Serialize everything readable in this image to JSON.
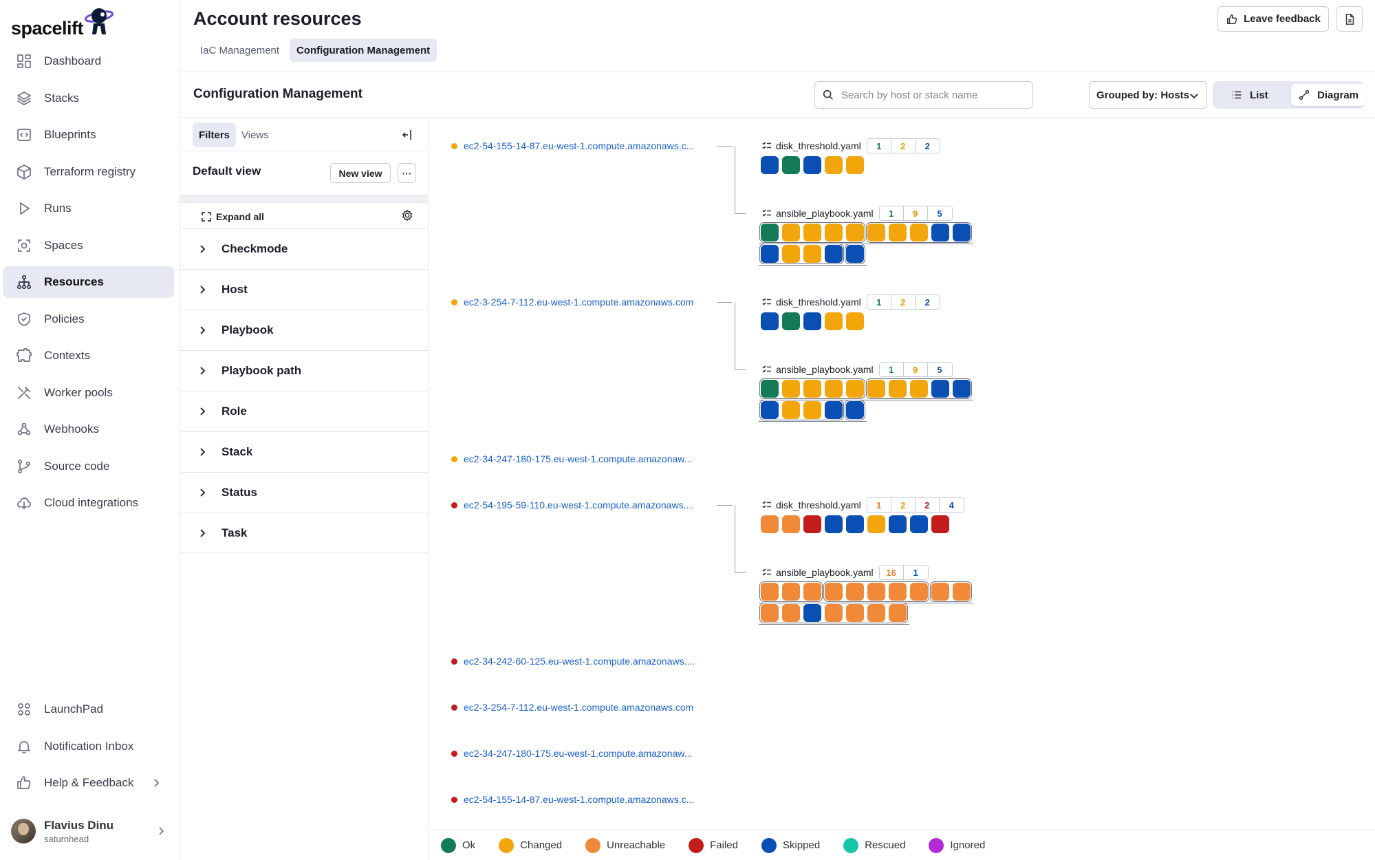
{
  "app": {
    "logo_text": "spacelift"
  },
  "sidebar": {
    "items": [
      {
        "label": "Dashboard",
        "icon": "dashboard-icon"
      },
      {
        "label": "Stacks",
        "icon": "stacks-icon"
      },
      {
        "label": "Blueprints",
        "icon": "blueprints-icon"
      },
      {
        "label": "Terraform registry",
        "icon": "registry-icon"
      },
      {
        "label": "Runs",
        "icon": "play-icon"
      },
      {
        "label": "Spaces",
        "icon": "spaces-icon"
      },
      {
        "label": "Resources",
        "icon": "resources-icon",
        "active": true
      },
      {
        "label": "Policies",
        "icon": "policies-icon"
      },
      {
        "label": "Contexts",
        "icon": "contexts-icon"
      },
      {
        "label": "Worker pools",
        "icon": "worker-pools-icon"
      },
      {
        "label": "Webhooks",
        "icon": "webhooks-icon"
      },
      {
        "label": "Source code",
        "icon": "source-code-icon"
      },
      {
        "label": "Cloud integrations",
        "icon": "cloud-icon"
      }
    ],
    "bottom_items": [
      {
        "label": "LaunchPad",
        "icon": "launchpad-icon"
      },
      {
        "label": "Notification Inbox",
        "icon": "bell-icon"
      },
      {
        "label": "Help & Feedback",
        "icon": "thumbs-up-icon"
      }
    ],
    "user": {
      "name": "Flavius Dinu",
      "handle": "saturnhead"
    }
  },
  "header": {
    "title": "Account resources",
    "tabs": [
      "IaC Management",
      "Configuration Management"
    ],
    "active_tab": 1,
    "feedback_label": "Leave feedback"
  },
  "subheader": {
    "title": "Configuration Management",
    "search_placeholder": "Search by host or stack name",
    "group_by": "Grouped by: Hosts",
    "view_list": "List",
    "view_diagram": "Diagram"
  },
  "filters": {
    "tabs": [
      "Filters",
      "Views"
    ],
    "default_view": "Default view",
    "new_view": "New view",
    "more": "···",
    "expand_all": "Expand all",
    "rows": [
      "Checkmode",
      "Host",
      "Playbook",
      "Playbook path",
      "Role",
      "Stack",
      "Status",
      "Task"
    ]
  },
  "colors": {
    "ok": "#157a56",
    "changed": "#f2a60c",
    "unreachable": "#f08a38",
    "failed": "#c21c1c",
    "skipped": "#0a4fb3",
    "rescued": "#18c5a8",
    "ignored": "#b32bd6",
    "badge_ok": "#157a56",
    "badge_changed": "#e49b00",
    "badge_unreachable": "#e8802f",
    "badge_failed": "#b51a1a",
    "badge_skipped": "#0a4fb3"
  },
  "hosts": [
    {
      "name": "ec2-54-155-14-87.eu-west-1.compute.amazonaws.c...",
      "status": "changed",
      "playbooks": [
        {
          "name": "disk_threshold.yaml",
          "badges": [
            [
              "ok",
              "1"
            ],
            [
              "changed",
              "2"
            ],
            [
              "skipped",
              "2"
            ]
          ],
          "rows": [
            [
              "skipped",
              "ok",
              "skipped",
              "changed",
              "changed"
            ]
          ],
          "groups": []
        },
        {
          "name": "ansible_playbook.yaml",
          "badges": [
            [
              "ok",
              "1"
            ],
            [
              "changed",
              "9"
            ],
            [
              "skipped",
              "5"
            ]
          ],
          "rows": [
            [
              "ok",
              "changed",
              "changed",
              "changed",
              "changed",
              "changed",
              "changed",
              "changed",
              "skipped",
              "skipped"
            ],
            [
              "skipped",
              "changed",
              "changed",
              "skipped",
              "skipped"
            ]
          ],
          "groups": [
            [
              0,
              0,
              5
            ],
            [
              0,
              5,
              5
            ],
            [
              1,
              0,
              4
            ],
            [
              1,
              4,
              1
            ]
          ]
        }
      ]
    },
    {
      "name": "ec2-3-254-7-112.eu-west-1.compute.amazonaws.com",
      "status": "changed",
      "playbooks": [
        {
          "name": "disk_threshold.yaml",
          "badges": [
            [
              "ok",
              "1"
            ],
            [
              "changed",
              "2"
            ],
            [
              "skipped",
              "2"
            ]
          ],
          "rows": [
            [
              "skipped",
              "ok",
              "skipped",
              "changed",
              "changed"
            ]
          ],
          "groups": []
        },
        {
          "name": "ansible_playbook.yaml",
          "badges": [
            [
              "ok",
              "1"
            ],
            [
              "changed",
              "9"
            ],
            [
              "skipped",
              "5"
            ]
          ],
          "rows": [
            [
              "ok",
              "changed",
              "changed",
              "changed",
              "changed",
              "changed",
              "changed",
              "changed",
              "skipped",
              "skipped"
            ],
            [
              "skipped",
              "changed",
              "changed",
              "skipped",
              "skipped"
            ]
          ],
          "groups": [
            [
              0,
              0,
              5
            ],
            [
              0,
              5,
              5
            ],
            [
              1,
              0,
              4
            ],
            [
              1,
              4,
              1
            ]
          ]
        }
      ]
    },
    {
      "name": "ec2-34-247-180-175.eu-west-1.compute.amazonaw...",
      "status": "changed",
      "playbooks": []
    },
    {
      "name": "ec2-54-195-59-110.eu-west-1.compute.amazonaws....",
      "status": "failed",
      "playbooks": [
        {
          "name": "disk_threshold.yaml",
          "badges": [
            [
              "unreachable",
              "1"
            ],
            [
              "changed",
              "2"
            ],
            [
              "failed",
              "2"
            ],
            [
              "skipped",
              "4"
            ]
          ],
          "rows": [
            [
              "unreachable",
              "unreachable",
              "failed",
              "skipped",
              "skipped",
              "changed",
              "skipped",
              "skipped",
              "failed"
            ]
          ],
          "groups": []
        },
        {
          "name": "ansible_playbook.yaml",
          "badges": [
            [
              "unreachable",
              "16"
            ],
            [
              "skipped",
              "1"
            ]
          ],
          "rows": [
            [
              "unreachable",
              "unreachable",
              "unreachable",
              "unreachable",
              "unreachable",
              "unreachable",
              "unreachable",
              "unreachable",
              "unreachable",
              "unreachable"
            ],
            [
              "unreachable",
              "unreachable",
              "skipped",
              "unreachable",
              "unreachable",
              "unreachable",
              "unreachable"
            ]
          ],
          "groups": [
            [
              0,
              0,
              3
            ],
            [
              0,
              3,
              5
            ],
            [
              0,
              8,
              2
            ],
            [
              1,
              0,
              7
            ]
          ]
        }
      ]
    },
    {
      "name": "ec2-34-242-60-125.eu-west-1.compute.amazonaws....",
      "status": "failed",
      "playbooks": []
    },
    {
      "name": "ec2-3-254-7-112.eu-west-1.compute.amazonaws.com",
      "status": "failed",
      "playbooks": []
    },
    {
      "name": "ec2-34-247-180-175.eu-west-1.compute.amazonaw...",
      "status": "failed",
      "playbooks": []
    },
    {
      "name": "ec2-54-155-14-87.eu-west-1.compute.amazonaws.c...",
      "status": "failed",
      "playbooks": []
    }
  ],
  "legend": [
    {
      "label": "Ok",
      "status": "ok"
    },
    {
      "label": "Changed",
      "status": "changed"
    },
    {
      "label": "Unreachable",
      "status": "unreachable"
    },
    {
      "label": "Failed",
      "status": "failed"
    },
    {
      "label": "Skipped",
      "status": "skipped"
    },
    {
      "label": "Rescued",
      "status": "rescued"
    },
    {
      "label": "Ignored",
      "status": "ignored"
    }
  ]
}
